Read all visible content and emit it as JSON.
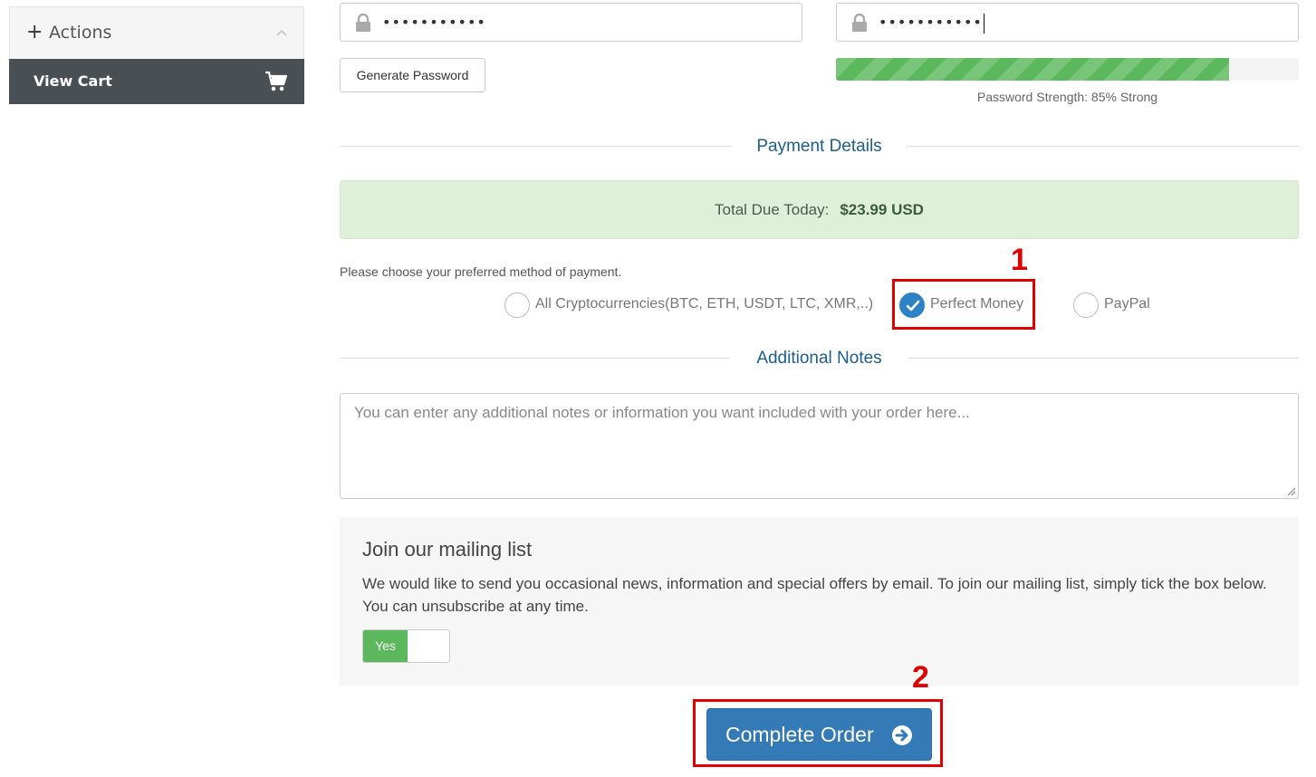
{
  "sidebar": {
    "actions_label": "Actions",
    "view_cart_label": "View Cart"
  },
  "password": {
    "field1_value": "•••••••••••",
    "field2_value": "•••••••••••",
    "generate_label": "Generate Password",
    "strength_percent": 85,
    "strength_text": "Password Strength: 85% Strong"
  },
  "payment": {
    "section_title": "Payment Details",
    "total_label": "Total Due Today:",
    "total_value": "$23.99 USD",
    "prompt": "Please choose your preferred method of payment.",
    "methods": [
      {
        "label": "All Cryptocurrencies(BTC, ETH, USDT, LTC, XMR,..)",
        "selected": false
      },
      {
        "label": "Perfect Money",
        "selected": true
      },
      {
        "label": "PayPal",
        "selected": false
      }
    ]
  },
  "notes": {
    "section_title": "Additional Notes",
    "placeholder": "You can enter any additional notes or information you want included with your order here..."
  },
  "mailing": {
    "title": "Join our mailing list",
    "text": "We would like to send you occasional news, information and special offers by email. To join our mailing list, simply tick the box below. You can unsubscribe at any time.",
    "toggle_label": "Yes"
  },
  "complete_label": "Complete Order",
  "annotations": {
    "step1": "1",
    "step2": "2"
  },
  "colors": {
    "sidebar_dark": "#4a4f54",
    "accent_blue": "#337ab7",
    "success_green": "#5cb85c",
    "annotation_red": "#e00000"
  }
}
